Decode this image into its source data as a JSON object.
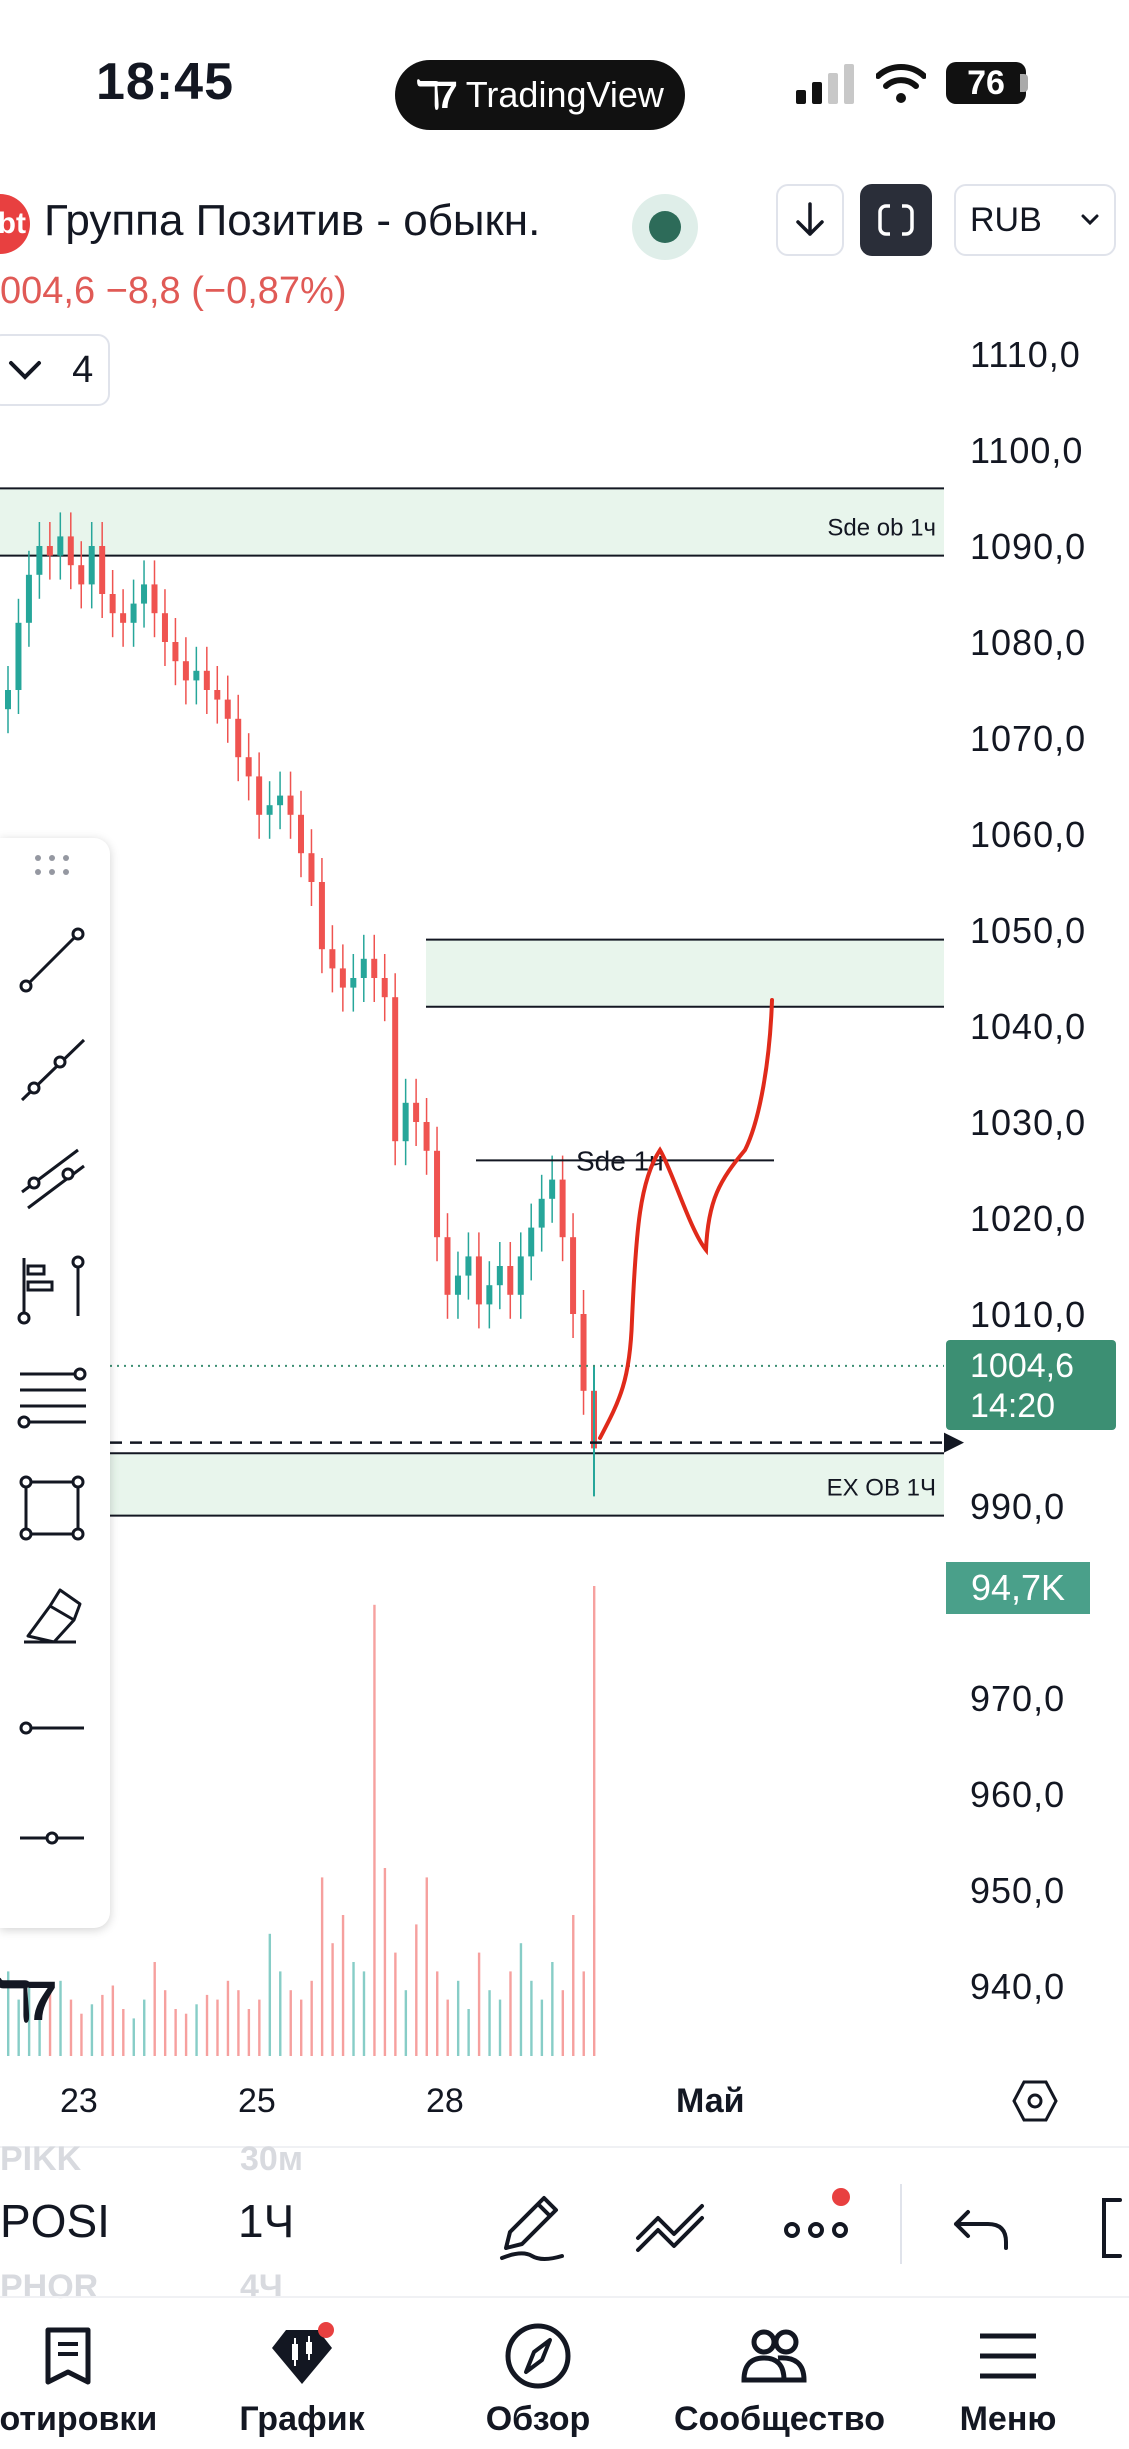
{
  "status_bar": {
    "time": "18:45",
    "app_pill": "TradingView",
    "battery": "76"
  },
  "header": {
    "symbol_badge": "bt",
    "symbol_name": "Группа Позитив - обыкн.",
    "currency": "RUB",
    "price_change": "004,6  −8,8 (−0,87%)",
    "interval_value": "4"
  },
  "colors": {
    "up": "#26a69a",
    "down": "#ef5350",
    "zone_fill": "#e8f5ec",
    "drawing": "#e02a1a",
    "last_price": "#3c8f73"
  },
  "chart_data": {
    "type": "candlestick",
    "ylim": [
      933,
      1116
    ],
    "y_ticks": [
      "1110,0",
      "1100,0",
      "1090,0",
      "1080,0",
      "1070,0",
      "1060,0",
      "1050,0",
      "1040,0",
      "1030,0",
      "1020,0",
      "1010,0",
      "990,0",
      "970,0",
      "960,0",
      "950,0",
      "940,0"
    ],
    "x_ticks": [
      "23",
      "25",
      "28",
      "Май"
    ],
    "last_price": "1004,6",
    "countdown": "14:20",
    "volume_label": "94,7K",
    "close_series": [
      1075,
      1082,
      1087,
      1090,
      1089,
      1091,
      1088,
      1086,
      1090,
      1085,
      1083,
      1082,
      1084,
      1086,
      1083,
      1080,
      1078,
      1076,
      1077,
      1075,
      1074,
      1072,
      1068,
      1066,
      1062,
      1063,
      1064,
      1062,
      1058,
      1055,
      1048,
      1046,
      1044,
      1045,
      1047,
      1045,
      1043,
      1028,
      1032,
      1030,
      1027,
      1018,
      1012,
      1014,
      1016,
      1011,
      1013,
      1015,
      1012,
      1016,
      1019,
      1022,
      1024,
      1018,
      1010,
      1002,
      996
    ],
    "volume_series": [
      18,
      12,
      15,
      10,
      14,
      16,
      12,
      9,
      11,
      13,
      15,
      10,
      8,
      12,
      20,
      14,
      10,
      9,
      11,
      13,
      12,
      16,
      14,
      10,
      12,
      26,
      18,
      14,
      12,
      16,
      38,
      24,
      30,
      20,
      18,
      96,
      40,
      22,
      14,
      28,
      38,
      18,
      12,
      16,
      10,
      22,
      14,
      12,
      18,
      24,
      16,
      12,
      20,
      14,
      30,
      18,
      100
    ],
    "zones": [
      {
        "label": "Sde ob 1ч",
        "top": 1096,
        "bottom": 1089
      },
      {
        "label": "",
        "top": 1049,
        "bottom": 1042
      },
      {
        "label": "EX OB 1Ч",
        "top": 995.5,
        "bottom": 989
      }
    ],
    "hline_label": "Sde 1ч",
    "hline_value": 1026,
    "dashed_level": 996.6,
    "dotted_level": 1004.6
  },
  "xaxis": {
    "labels": [
      "23",
      "25",
      "28",
      "Май"
    ]
  },
  "symbol_picker": {
    "prev": "PIKK",
    "current": "POSI",
    "next": "PHOR",
    "tf_prev": "30м",
    "tf_current": "1Ч",
    "tf_next": "4Ч"
  },
  "bottom_nav": [
    {
      "label": "Котировки"
    },
    {
      "label": "График"
    },
    {
      "label": "Обзор"
    },
    {
      "label": "Сообщество"
    },
    {
      "label": "Меню"
    }
  ]
}
